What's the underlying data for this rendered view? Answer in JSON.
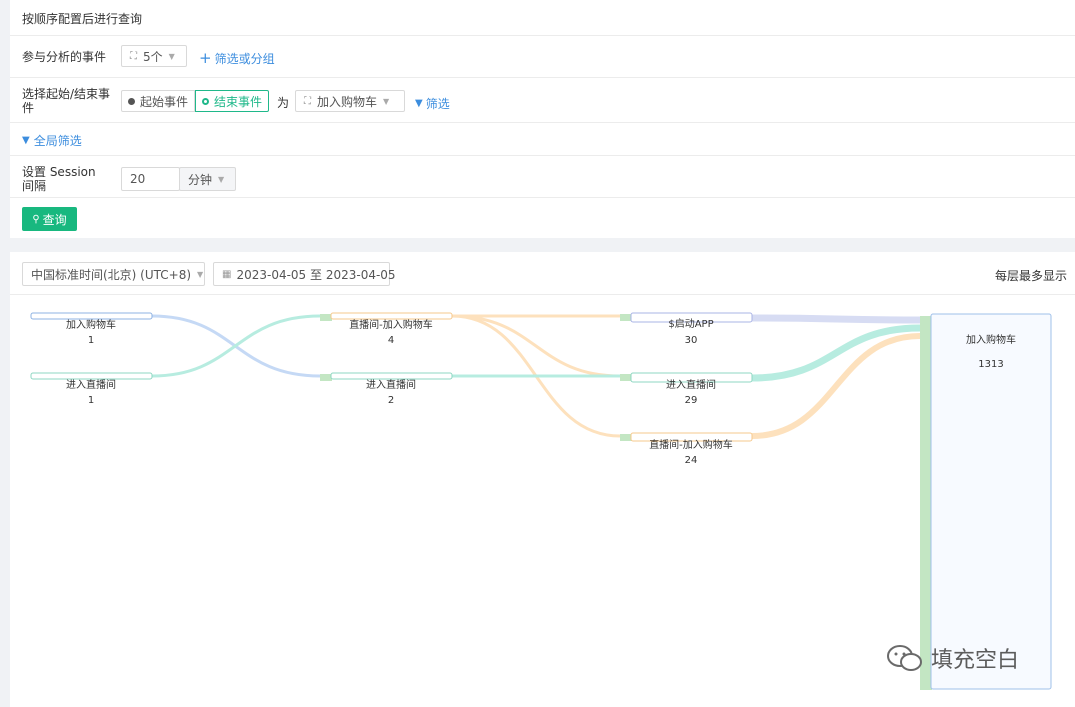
{
  "header": {
    "title": "按顺序配置后进行查询"
  },
  "events_row": {
    "label": "参与分析的事件",
    "count_value": "5个",
    "filter_group_link": "筛选或分组"
  },
  "start_end_row": {
    "label": "选择起始/结束事件",
    "start_option": "起始事件",
    "end_option": "结束事件",
    "as_text": "为",
    "event_value": "加入购物车",
    "filter_link": "筛选"
  },
  "global_filter": {
    "label": "全局筛选"
  },
  "session_row": {
    "label": "设置 Session 间隔",
    "value": "20",
    "unit": "分钟"
  },
  "query_button": {
    "label": "查询"
  },
  "toolbar": {
    "timezone": "中国标准时间(北京) (UTC+8)",
    "date_range": "2023-04-05 至 2023-04-05",
    "max_per_layer": "每层最多显示"
  },
  "sankey": {
    "nodes": [
      {
        "name": "加入购物车",
        "value": "1"
      },
      {
        "name": "进入直播间",
        "value": "1"
      },
      {
        "name": "直播间-加入购物车",
        "value": "4"
      },
      {
        "name": "进入直播间",
        "value": "2"
      },
      {
        "name": "$启动APP",
        "value": "30"
      },
      {
        "name": "进入直播间",
        "value": "29"
      },
      {
        "name": "直播间-加入购物车",
        "value": "24"
      },
      {
        "name": "加入购物车",
        "value": "1313"
      }
    ]
  },
  "watermark": {
    "text": "填充空白"
  },
  "colors": {
    "accent_green": "#18b87f",
    "link_blue": "#3c8dde",
    "flow_blue": "#c5d9f5",
    "flow_teal": "#b7ece0",
    "flow_orange": "#fde1bd",
    "flow_purple": "#d7dcf3"
  }
}
